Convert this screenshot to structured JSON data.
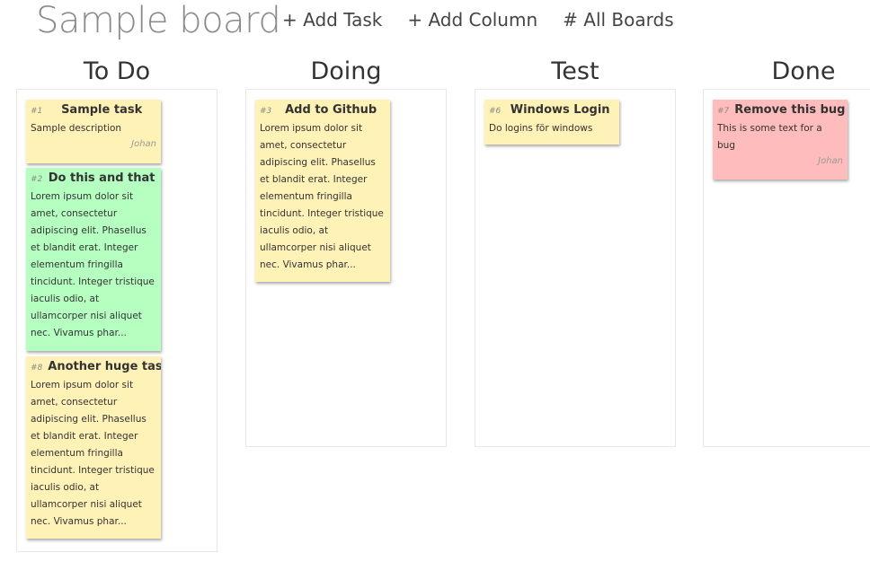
{
  "board": {
    "title": "Sample board"
  },
  "nav": {
    "add_task": "+ Add Task",
    "add_column": "+ Add Column",
    "all_boards": "# All Boards"
  },
  "columns": [
    {
      "title": "To Do",
      "tasks": [
        {
          "id": "#1",
          "title": "Sample task",
          "description": "Sample description",
          "owner": "Johan",
          "color": "#fff2b7"
        },
        {
          "id": "#2",
          "title": "Do this and that",
          "description": "Lorem ipsum dolor sit amet, consectetur adipiscing elit. Phasellus et blandit erat. Integer elementum fringilla tincidunt. Integer tristique iaculis odio, at ullamcorper nisi aliquet nec. Vivamus phar...",
          "owner": "",
          "color": "#b5ffc1"
        },
        {
          "id": "#8",
          "title": "Another huge task",
          "description": "Lorem ipsum dolor sit amet, consectetur adipiscing elit. Phasellus et blandit erat. Integer elementum fringilla tincidunt. Integer tristique iaculis odio, at ullamcorper nisi aliquet nec. Vivamus phar...",
          "owner": "",
          "color": "#fff2b7"
        }
      ]
    },
    {
      "title": "Doing",
      "tasks": [
        {
          "id": "#3",
          "title": "Add to Github",
          "description": "Lorem ipsum dolor sit amet, consectetur adipiscing elit. Phasellus et blandit erat. Integer elementum fringilla tincidunt. Integer tristique iaculis odio, at ullamcorper nisi aliquet nec. Vivamus phar...",
          "owner": "",
          "color": "#fff2b7"
        }
      ]
    },
    {
      "title": "Test",
      "tasks": [
        {
          "id": "#6",
          "title": "Windows Login",
          "description": "Do logins för windows",
          "owner": "",
          "color": "#fff2b7"
        }
      ]
    },
    {
      "title": "Done",
      "tasks": [
        {
          "id": "#7",
          "title": "Remove this bug",
          "description": "This is some text for a bug",
          "owner": "Johan",
          "color": "#ffbcbc"
        }
      ]
    }
  ]
}
